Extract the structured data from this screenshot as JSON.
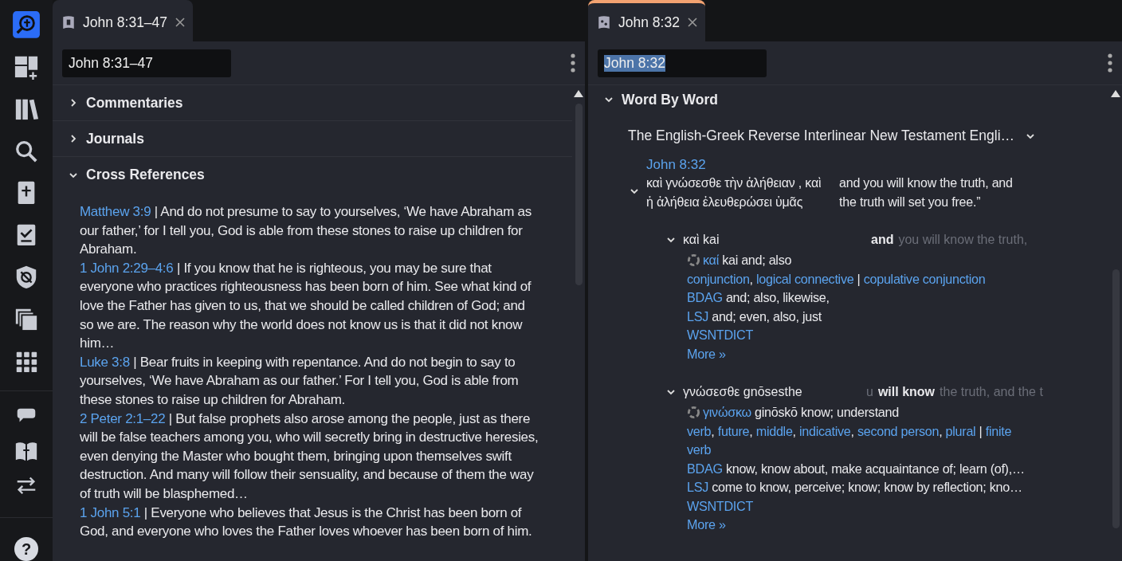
{
  "sidebar": {
    "help_label": "?"
  },
  "left_panel": {
    "tab": {
      "label": "John 8:31–47",
      "selected": false
    },
    "reference_input": {
      "value": "John 8:31–47"
    },
    "sections": [
      {
        "title": "Commentaries",
        "expanded": false
      },
      {
        "title": "Journals",
        "expanded": false
      },
      {
        "title": "Cross References",
        "expanded": true,
        "entries": [
          {
            "reference": "Matthew 3:9",
            "text": "| And do not presume to say to yourselves, ‘We have Abraham as our father,’ for I tell you, God is able from these stones to raise up children for Abraham."
          },
          {
            "reference": "1 John 2:29–4:6",
            "text": "| If you know that he is righteous, you may be sure that everyone who practices righteousness has been born of him. See what kind of love the Father has given to us, that we should be called children of God; and so we are. The reason why the world does not know us is that it did not know him…"
          },
          {
            "reference": "Luke 3:8",
            "text": "| Bear fruits in keeping with repentance. And do not begin to say to yourselves, ‘We have Abraham as our father.’ For I tell you, God is able from these stones to raise up children for Abraham."
          },
          {
            "reference": "2 Peter 2:1–22",
            "text": "| But false prophets also arose among the people, just as there will be false teachers among you, who will secretly bring in destructive heresies, even denying the Master who bought them, bringing upon themselves swift destruction. And many will follow their sensuality, and because of them the way of truth will be blasphemed…"
          },
          {
            "reference": "1 John 5:1",
            "text": "| Everyone who believes that Jesus is the Christ has been born of God, and everyone who loves the Father loves whoever has been born of him."
          }
        ]
      }
    ]
  },
  "right_panel": {
    "tab": {
      "label": "John 8:32",
      "selected": true
    },
    "reference_input": {
      "value": "John 8:32",
      "text_selected": true
    },
    "section": {
      "title": "Word By Word",
      "expanded": true
    },
    "resource": {
      "title": "The English-Greek Reverse Interlinear New Testament Engli…"
    },
    "verse": {
      "reference": "John 8:32",
      "expanded": true,
      "greek": "καὶ γνώσεσθε τὴν ἀλήθειαν , καὶ ἡ ἀλήθεια ἐλευθερώσει ὑμᾶς",
      "english": "and you will know the truth, and the truth will set you free.”"
    },
    "words": [
      {
        "greek": "καὶ kai",
        "expanded": true,
        "english": "and",
        "context_after": "you will know the truth,",
        "lemma": "καί",
        "gloss": "kai and; also",
        "morphology": [
          {
            "kind": "link",
            "text": "conjunction"
          },
          {
            "kind": "plain",
            "text": ", "
          },
          {
            "kind": "link",
            "text": "logical connective"
          },
          {
            "kind": "plain",
            "text": " | "
          },
          {
            "kind": "link",
            "text": "copulative conjunction"
          }
        ],
        "dictionaries": [
          {
            "name": "BDAG",
            "text": "and; also, likewise,"
          },
          {
            "name": "LSJ",
            "text": "and; even, also, just"
          },
          {
            "name": "WSNTDICT"
          }
        ],
        "more": "More »"
      },
      {
        "greek": "γνώσεσθε gnōsesthe",
        "expanded": true,
        "context_before": "u",
        "english": "will know",
        "context_after": "the truth, and the t",
        "lemma": "γινώσκω",
        "gloss": "ginōskō know; understand",
        "morphology": [
          {
            "kind": "link",
            "text": "verb"
          },
          {
            "kind": "plain",
            "text": ", "
          },
          {
            "kind": "link",
            "text": "future"
          },
          {
            "kind": "plain",
            "text": ", "
          },
          {
            "kind": "link",
            "text": "middle"
          },
          {
            "kind": "plain",
            "text": ", "
          },
          {
            "kind": "link",
            "text": "indicative"
          },
          {
            "kind": "plain",
            "text": ", "
          },
          {
            "kind": "link",
            "text": "second person"
          },
          {
            "kind": "plain",
            "text": ", "
          },
          {
            "kind": "link",
            "text": "plural"
          },
          {
            "kind": "plain",
            "text": " | "
          },
          {
            "kind": "link",
            "text": "finite"
          },
          {
            "kind": "space"
          },
          {
            "kind": "link",
            "text": "verb"
          }
        ],
        "dictionaries": [
          {
            "name": "BDAG",
            "text": "know, know about, make acquaintance of; learn (of),…"
          },
          {
            "name": "LSJ",
            "text": "come to know, perceive; know; know by reflection; kno…"
          },
          {
            "name": "WSNTDICT"
          }
        ],
        "more": "More »"
      }
    ]
  }
}
